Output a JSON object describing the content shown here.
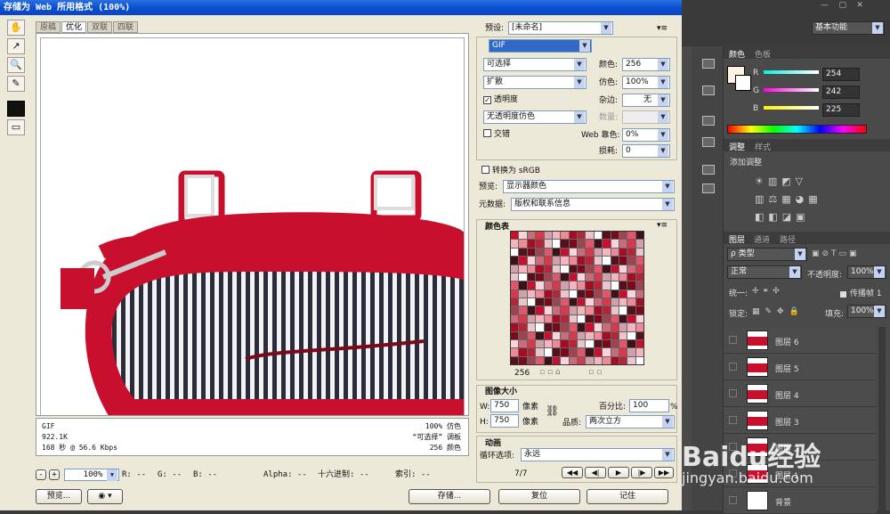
{
  "window": {
    "title": "存储为 Web 所用格式 (100%)"
  },
  "tabs": [
    "原稿",
    "优化",
    "双联",
    "四联"
  ],
  "info": {
    "format": "GIF",
    "size": "922.1K",
    "time": "168 秒 @ 56.6 Kbps",
    "dither": "100% 仿色",
    "palette": "“可选择” 调板",
    "colors": "256 颜色"
  },
  "status": {
    "zoom": "100%",
    "r": "R: --",
    "g": "G: --",
    "b": "B: --",
    "alpha": "Alpha: --",
    "hex": "十六进制: --",
    "index": "索引: --"
  },
  "buttons": {
    "preview": "预览...",
    "save": "存储...",
    "reset": "复位",
    "remember": "记住"
  },
  "settings": {
    "preset_label": "预设:",
    "preset_value": "[未命名]",
    "format": "GIF",
    "reduction": "可选择",
    "dither_algo": "扩散",
    "transparency": "透明度",
    "transp_dither": "无透明度仿色",
    "interlaced": "交错",
    "colors_label": "颜色:",
    "colors_value": "256",
    "dither_label": "仿色:",
    "dither_value": "100%",
    "matte_label": "杂边:",
    "matte_value": "无",
    "amount_label": "数量:",
    "websnap_label": "Web 靠色:",
    "websnap_value": "0%",
    "lossy_label": "损耗:",
    "lossy_value": "0",
    "srgb": "转换为 sRGB",
    "preview_label": "预览:",
    "preview_value": "显示器颜色",
    "meta_label": "元数据:",
    "meta_value": "版权和联系信息"
  },
  "color_table": {
    "title": "颜色表",
    "count": "256"
  },
  "image_size": {
    "title": "图像大小",
    "w_label": "W:",
    "w_value": "750",
    "h_label": "H:",
    "h_value": "750",
    "unit": "像素",
    "percent_label": "百分比:",
    "percent_value": "100",
    "percent_unit": "%",
    "quality_label": "品质:",
    "quality_value": "两次立方"
  },
  "animation": {
    "title": "动画",
    "loop_label": "循环选项:",
    "loop_value": "永远",
    "frame": "7/7"
  },
  "ps": {
    "workspace": "基本功能",
    "color_tab": "颜色",
    "swatch_tab": "色板",
    "r_label": "R",
    "g_label": "G",
    "b_label": "B",
    "r": "254",
    "g": "242",
    "b": "225",
    "adjust_tab": "调整",
    "style_tab": "样式",
    "add_adjust": "添加调整",
    "layers_tab": "图层",
    "channels_tab": "通道",
    "paths_tab": "路径",
    "kind": "ρ 类型",
    "blend": "正常",
    "opacity_label": "不透明度:",
    "opacity": "100%",
    "unify": "统一:",
    "propagate": "传播帧 1",
    "lock": "锁定:",
    "fill_label": "填充:",
    "fill": "100%",
    "layers": [
      "图层 6",
      "图层 5",
      "图层 4",
      "图层 3",
      "图层 2",
      "图层 1",
      "背景"
    ],
    "watermark": "Baidu经验",
    "watermark_url": "jingyan.baidu.com"
  },
  "colors": {
    "bag_red": "#c8102e",
    "ps_bg": "#4a4a4a"
  }
}
